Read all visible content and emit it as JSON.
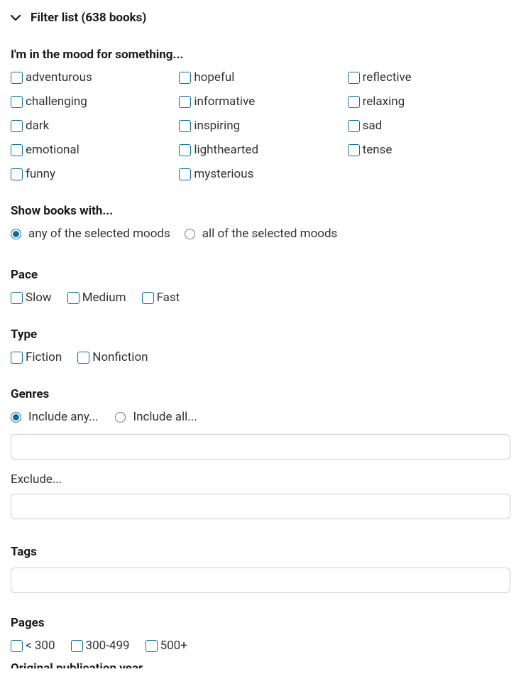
{
  "header": {
    "title": "Filter list (638 books)"
  },
  "mood": {
    "heading": "I'm in the mood for something...",
    "options": [
      "adventurous",
      "challenging",
      "dark",
      "emotional",
      "funny",
      "hopeful",
      "informative",
      "inspiring",
      "lighthearted",
      "mysterious",
      "reflective",
      "relaxing",
      "sad",
      "tense"
    ]
  },
  "show_books": {
    "heading": "Show books with...",
    "any_label": "any of the selected moods",
    "all_label": "all of the selected moods",
    "selected": "any"
  },
  "pace": {
    "heading": "Pace",
    "options": [
      "Slow",
      "Medium",
      "Fast"
    ]
  },
  "type": {
    "heading": "Type",
    "options": [
      "Fiction",
      "Nonfiction"
    ]
  },
  "genres": {
    "heading": "Genres",
    "include_any_label": "Include any...",
    "include_all_label": "Include all...",
    "selected": "any",
    "exclude_label": "Exclude..."
  },
  "tags": {
    "heading": "Tags"
  },
  "pages": {
    "heading": "Pages",
    "options": [
      "< 300",
      "300-499",
      "500+"
    ]
  },
  "publication": {
    "heading": "Original publication year"
  }
}
